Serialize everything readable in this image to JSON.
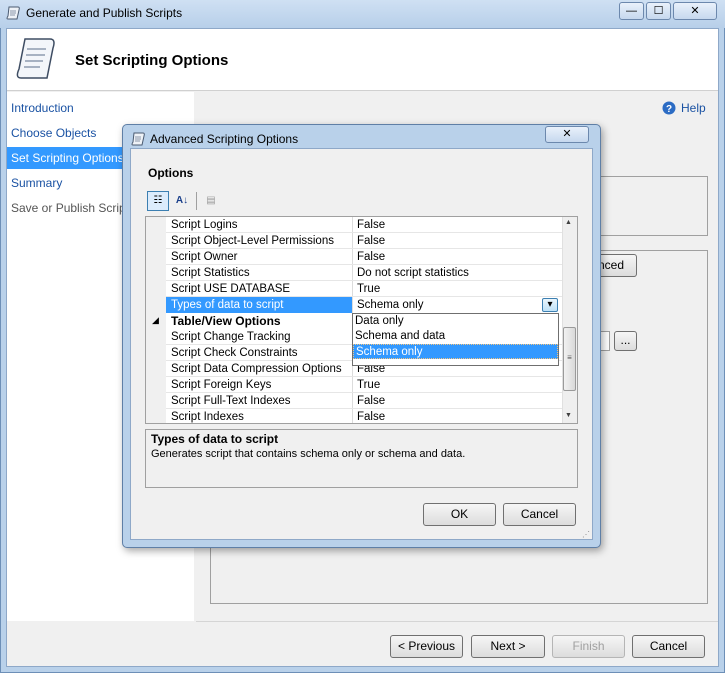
{
  "main_window": {
    "title": "Generate and Publish Scripts",
    "page_title": "Set Scripting Options",
    "help_label": "Help",
    "minimize_glyph": "—",
    "maximize_glyph": "☐",
    "close_glyph": "✕",
    "nav": {
      "items": [
        {
          "label": "Introduction"
        },
        {
          "label": "Choose Objects"
        },
        {
          "label": "Set Scripting Options"
        },
        {
          "label": "Summary"
        },
        {
          "label": "Save or Publish Scripts"
        }
      ]
    },
    "background_advanced_button": "nced",
    "background_browse_button": "...",
    "buttons": {
      "previous": "< Previous",
      "next": "Next >",
      "finish": "Finish",
      "cancel": "Cancel"
    }
  },
  "dialog": {
    "title": "Advanced Scripting Options",
    "close_glyph": "✕",
    "options_label": "Options",
    "toolbar": {
      "categorized_glyph": "☷",
      "alphabetical_glyph": "A↓",
      "pages_glyph": "▤"
    },
    "properties": [
      {
        "name": "Script Logins",
        "value": "False"
      },
      {
        "name": "Script Object-Level Permissions",
        "value": "False"
      },
      {
        "name": "Script Owner",
        "value": "False"
      },
      {
        "name": "Script Statistics",
        "value": "Do not script statistics"
      },
      {
        "name": "Script USE DATABASE",
        "value": "True"
      },
      {
        "name": "Types of data to script",
        "value": "Schema only"
      }
    ],
    "category": {
      "toggle_glyph": "◢",
      "label": "Table/View Options"
    },
    "table_properties": [
      {
        "name": "Script Change Tracking",
        "value": ""
      },
      {
        "name": "Script Check Constraints",
        "value": ""
      },
      {
        "name": "Script Data Compression Options",
        "value": "False"
      },
      {
        "name": "Script Foreign Keys",
        "value": "True"
      },
      {
        "name": "Script Full-Text Indexes",
        "value": "False"
      },
      {
        "name": "Script Indexes",
        "value": "False"
      }
    ],
    "dropdown_arrow": "▾",
    "dropdown_options": [
      "Data only",
      "Schema and data",
      "Schema only"
    ],
    "dropdown_selected": "Schema only",
    "description": {
      "title": "Types of data to script",
      "text": "Generates script that contains schema only or schema and data."
    },
    "ok_label": "OK",
    "cancel_label": "Cancel",
    "scroll_up": "▲",
    "scroll_down": "▼"
  },
  "colors": {
    "selection": "#3399ff",
    "link": "#1a52a3",
    "window_frame": "#b9d1ea"
  }
}
